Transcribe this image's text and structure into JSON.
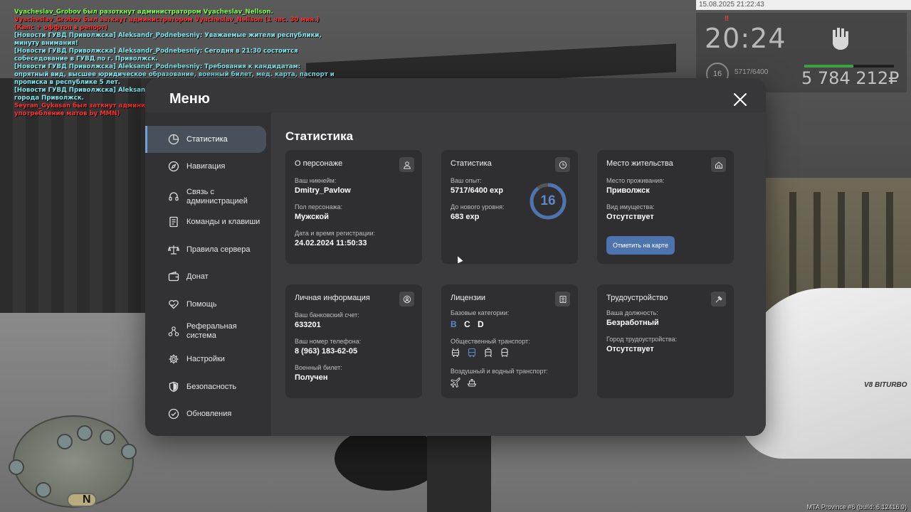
{
  "chat": [
    {
      "text": "Vyacheslav_Grobov был разоткнут администратором Vyacheslav_Nellson.",
      "color": "green"
    },
    {
      "text": "Vyacheslav_Grobov был заткнут администратором Vyacheslav_Nellson (1 час. 30 мин.) (Капс + оффтоп в репорт)",
      "color": "red"
    },
    {
      "text": "[Новости ГУВД Приволжска] Aleksandr_Podnebesniy: Уважаемые жители республики, минуту внимания!",
      "color": "cyan"
    },
    {
      "text": "[Новости ГУВД Приволжска] Aleksandr_Podnebesniy: Сегодня в 21:30 состоится собеседование в ГУВД по г. Приволжск.",
      "color": "cyan"
    },
    {
      "text": "[Новости ГУВД Приволжска] Aleksandr_Podnebesniy: Требования к кандидатам: опрятный вид, высшее юридическое образование, военный билет, мед. карта, паспорт и прописка в республике 5 лет.",
      "color": "cyan"
    },
    {
      "text": "[Новости ГУВД Приволжска] Aleksandr_Podnebesniy: Место проведения - парковка УВД города Приволжск.",
      "color": "cyan"
    },
    {
      "text": "Seyran_Gykasan был заткнут администратором Vyacheslav_Nellson (1 час.) (Чрезмерное употребление матов by MMN)",
      "color": "red"
    }
  ],
  "hud": {
    "datetime": "15.08.2025 21:22:43",
    "time": "20:24",
    "level": "16",
    "exp": "5717/6400",
    "money": "5 784 212₽",
    "hunger_fraction": 0.55
  },
  "build": "MTA Province #6 (build: 6.12416.9)",
  "menu": {
    "title": "Меню",
    "nav": [
      {
        "label": "Статистика",
        "icon": "pie-chart-icon"
      },
      {
        "label": "Навигация",
        "icon": "compass-icon"
      },
      {
        "label": "Связь с администрацией",
        "icon": "headset-icon"
      },
      {
        "label": "Команды и клавиши",
        "icon": "document-icon"
      },
      {
        "label": "Правила сервера",
        "icon": "scales-icon"
      },
      {
        "label": "Донат",
        "icon": "wallet-icon"
      },
      {
        "label": "Помощь",
        "icon": "heart-hands-icon"
      },
      {
        "label": "Реферальная система",
        "icon": "referral-icon"
      },
      {
        "label": "Настройки",
        "icon": "gear-icon"
      },
      {
        "label": "Безопасность",
        "icon": "shield-icon"
      },
      {
        "label": "Обновления",
        "icon": "check-circle-icon"
      }
    ],
    "active_index": 0,
    "accent": "#6f9fdc"
  },
  "stats": {
    "title": "Статистика",
    "persona": {
      "title": "О персонаже",
      "nick_label": "Ваш никнейм:",
      "nick": "Dmitry_Pavlow",
      "gender_label": "Пол персонажа:",
      "gender": "Мужской",
      "reg_label": "Дата и время регистрации:",
      "reg": "24.02.2024 11:50:33"
    },
    "statistics": {
      "title": "Статистика",
      "exp_label": "Ваш опыт:",
      "exp": "5717/6400 exp",
      "next_label": "До нового уровня:",
      "next": "683 exp",
      "level": "16",
      "progress": 0.893
    },
    "residence": {
      "title": "Место жительства",
      "place_label": "Место проживания:",
      "place": "Приволжск",
      "property_label": "Вид имущества:",
      "property": "Отсутствует",
      "button": "Отметить на карте"
    },
    "personal": {
      "title": "Личная информация",
      "bank_label": "Ваш банковский счет:",
      "bank": "633201",
      "phone_label": "Ваш номер телефона:",
      "phone": "8 (963) 183-62-05",
      "military_label": "Военный билет:",
      "military": "Получен"
    },
    "licenses": {
      "title": "Лицензии",
      "base_label": "Базовые категории:",
      "letters": [
        "B",
        "C",
        "D"
      ],
      "public_label": "Общественный транспорт:",
      "air_label": "Воздушный и водный транспорт:"
    },
    "job": {
      "title": "Трудоустройство",
      "position_label": "Ваша должность:",
      "position": "Безработный",
      "city_label": "Город трудоустройства:",
      "city": "Отсутствует"
    }
  }
}
